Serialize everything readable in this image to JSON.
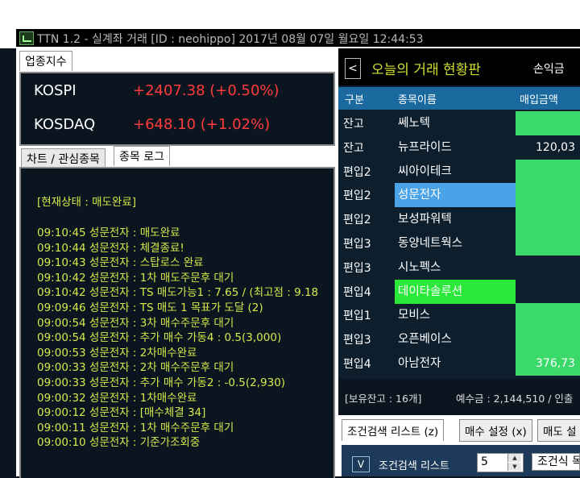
{
  "window": {
    "title": "TTN 1.2 - 실계좌 거래 [ID : neohippo] 2017년 08월 07일 월요일 12:44:53"
  },
  "index_panel": {
    "tab": "업종지수",
    "items": [
      {
        "name": "KOSPI",
        "value": "+2407.38 (+0.50%)"
      },
      {
        "name": "KOSDAQ",
        "value": "+648.10 (+1.02%)"
      }
    ]
  },
  "log_panel": {
    "tabs": [
      "차트 / 관심종목",
      "종목 로그"
    ],
    "status": "[현재상태 : 매도완료]",
    "lines": [
      "09:10:45 성문전자 : 매도완료",
      "09:10:44 성문전자 : 체결종료!",
      "09:10:43 성문전자 : 스탑로스 완료",
      "09:10:42 성문전자 : 1차 매도주문후 대기",
      "09:10:42 성문전자 : TS 매도가능1 : 7.65 / (최고점 : 9.18",
      "09:09:46 성문전자 : TS 매도 1 목표가 도달 (2)",
      "09:00:54 성문전자 : 3차 매수주문후 대기",
      "09:00:54 성문전자 : 추가 매수 가동4 : 0.5(3,000)",
      "09:00:53 성문전자 : 2차매수완료",
      "09:00:33 성문전자 : 2차 매수주문후 대기",
      "09:00:33 성문전자 : 추가 매수 가동2 : -0.5(2,930)",
      "09:00:32 성문전자 : 1차매수완료",
      "09:00:12 성문전자 : [매수체결 34]",
      "09:00:11 성문전자 : 1차 매수주문후 대기",
      "09:00:10 성문전자 : 기준가조회중"
    ]
  },
  "trade_board": {
    "back_label": "<",
    "title": "오늘의 거래 현황판",
    "header_right": "손익금",
    "columns": [
      "구분",
      "종목이름",
      "매입금액"
    ],
    "rows": [
      {
        "kind": "잔고",
        "name": "쎄노텍",
        "amount": "",
        "name_bg": "",
        "amount_bg": "#3bd96a"
      },
      {
        "kind": "잔고",
        "name": "뉴프라이드",
        "amount": "120,03",
        "name_bg": "",
        "amount_bg": ""
      },
      {
        "kind": "편입2",
        "name": "씨아이테크",
        "amount": "",
        "name_bg": "",
        "amount_bg": "#3bd96a"
      },
      {
        "kind": "편입2",
        "name": "성문전자",
        "amount": "",
        "name_bg": "#4aa3e6",
        "amount_bg": "#3bd96a"
      },
      {
        "kind": "편입2",
        "name": "보성파워텍",
        "amount": "",
        "name_bg": "",
        "amount_bg": "#3bd96a"
      },
      {
        "kind": "편입3",
        "name": "동양네트웍스",
        "amount": "",
        "name_bg": "",
        "amount_bg": "#3bd96a"
      },
      {
        "kind": "편입3",
        "name": "시노펙스",
        "amount": "",
        "name_bg": "",
        "amount_bg": ""
      },
      {
        "kind": "편입4",
        "name": "데이타솔루션",
        "amount": "",
        "name_bg": "#29e83a",
        "amount_bg": ""
      },
      {
        "kind": "편입1",
        "name": "모비스",
        "amount": "",
        "name_bg": "",
        "amount_bg": "#3bd96a"
      },
      {
        "kind": "편입3",
        "name": "오픈베이스",
        "amount": "",
        "name_bg": "",
        "amount_bg": "#3bd96a"
      },
      {
        "kind": "편입4",
        "name": "아남전자",
        "amount": "376,73",
        "name_bg": "",
        "amount_bg": "#3bd96a"
      }
    ],
    "summary_left": "[보유잔고 : 16개]",
    "summary_right": "예수금 : 2,144,510 / 인출"
  },
  "bottom_panel": {
    "tabs": [
      "조건검색 리스트 (z)",
      "매수 설정 (x)",
      "매도 설"
    ],
    "cond_button": "V",
    "cond_label": "조건검색 리스트",
    "spin_value": "5",
    "combo_value": "조건식 목"
  }
}
